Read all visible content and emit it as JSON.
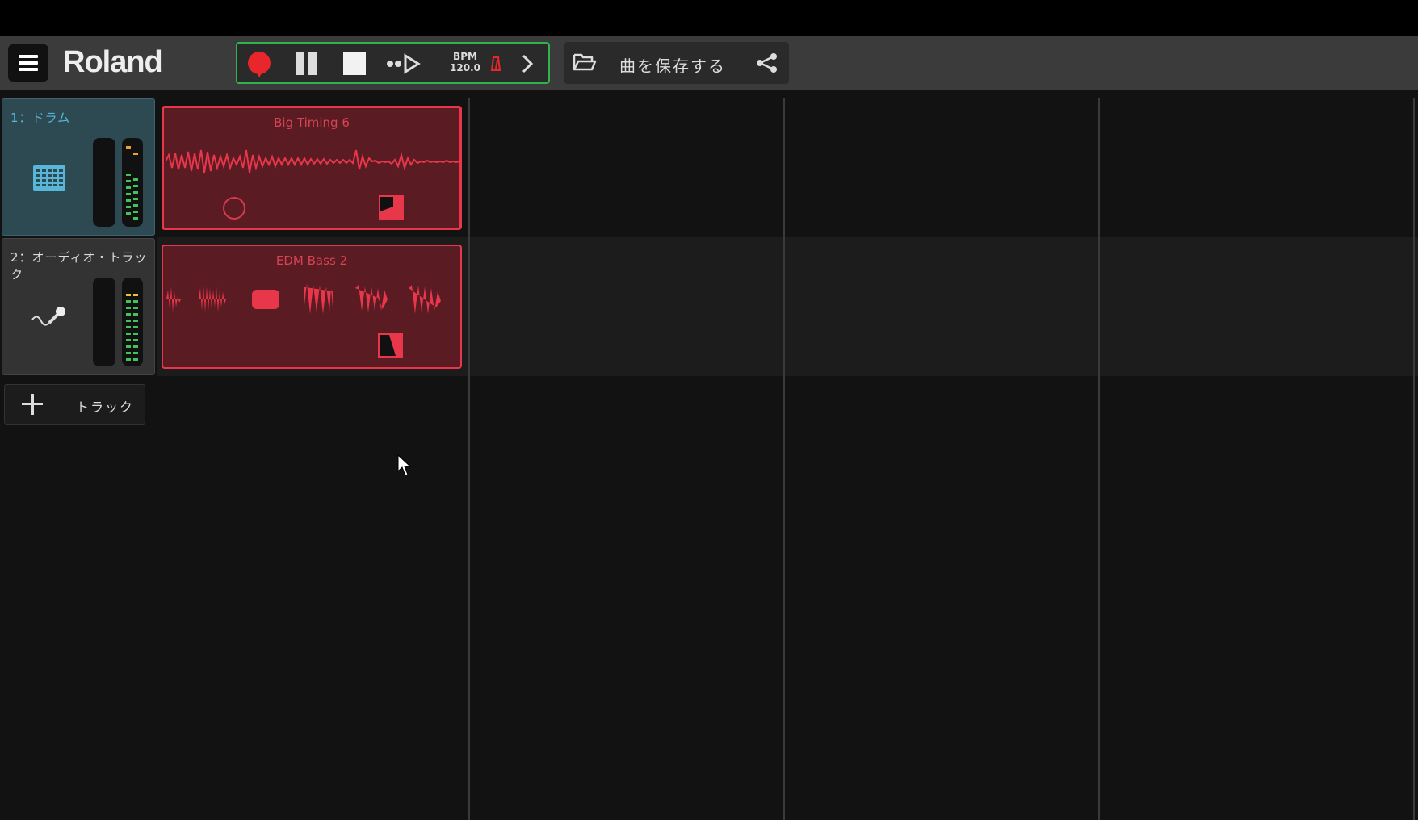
{
  "toolbar": {
    "logo": "Roland",
    "bpm_label": "BPM",
    "bpm_value": "120.0",
    "save_label": "曲を保存する",
    "accent_green": "#2eb34f",
    "record_color": "#e8262c"
  },
  "tracks": [
    {
      "name": "1：ドラム",
      "icon": "drum-pad-icon",
      "color": "#58b7d8"
    },
    {
      "name": "2：オーディオ・トラック",
      "icon": "microphone-icon",
      "color": "#dddddd"
    }
  ],
  "add_track_label": "トラック",
  "clips": [
    {
      "title": "Big Timing 6",
      "color": "#e8364a"
    },
    {
      "title": "EDM Bass 2",
      "color": "#e8364a"
    }
  ]
}
